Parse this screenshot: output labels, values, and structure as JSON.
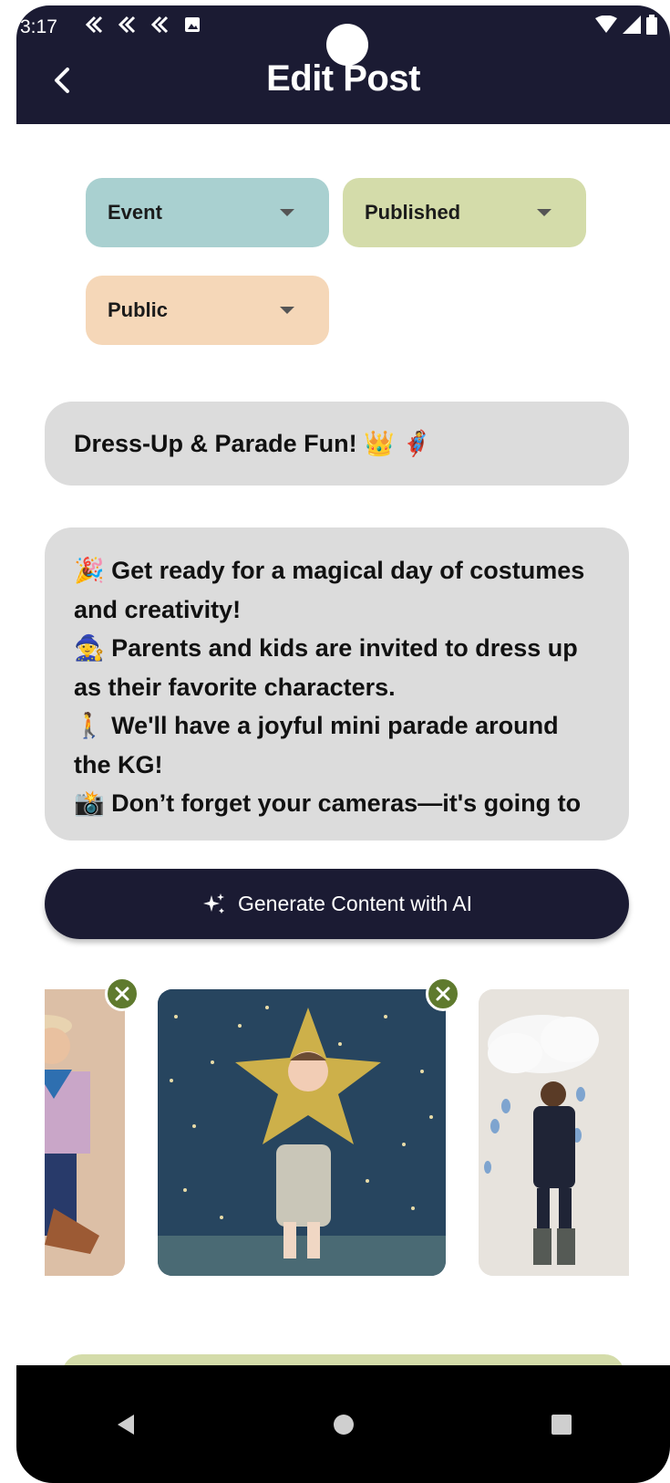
{
  "status_bar": {
    "time": "3:17"
  },
  "header": {
    "title": "Edit Post",
    "back_icon": "back-arrow-icon"
  },
  "dropdowns": {
    "type": {
      "value": "Event"
    },
    "status": {
      "value": "Published"
    },
    "visibility": {
      "value": "Public"
    }
  },
  "post": {
    "title": "Dress-Up & Parade Fun! 👑 🦸",
    "body": [
      "🎉 Get ready for a magical day of costumes and creativity!",
      "🧙 Parents and kids are invited to dress up as their favorite characters.",
      "🚶 We'll have a joyful mini parade around the KG!",
      "📸 Don’t forget your cameras—it's going to"
    ]
  },
  "ai_button": {
    "label": "Generate Content with AI",
    "icon": "sparkle-icon"
  },
  "images": [
    {
      "subject": "cowboy-costume-photo",
      "removable": true
    },
    {
      "subject": "star-costume-photo",
      "removable": true
    },
    {
      "subject": "rain-cloud-costume-photo",
      "removable": false
    }
  ],
  "colors": {
    "primary": "#1b1b33",
    "event_chip": "#a9d0d0",
    "published_chip": "#d4dcaa",
    "public_chip": "#f5d7b8",
    "field_bg": "#dcdcdc",
    "remove_badge": "#5f7a2e"
  }
}
